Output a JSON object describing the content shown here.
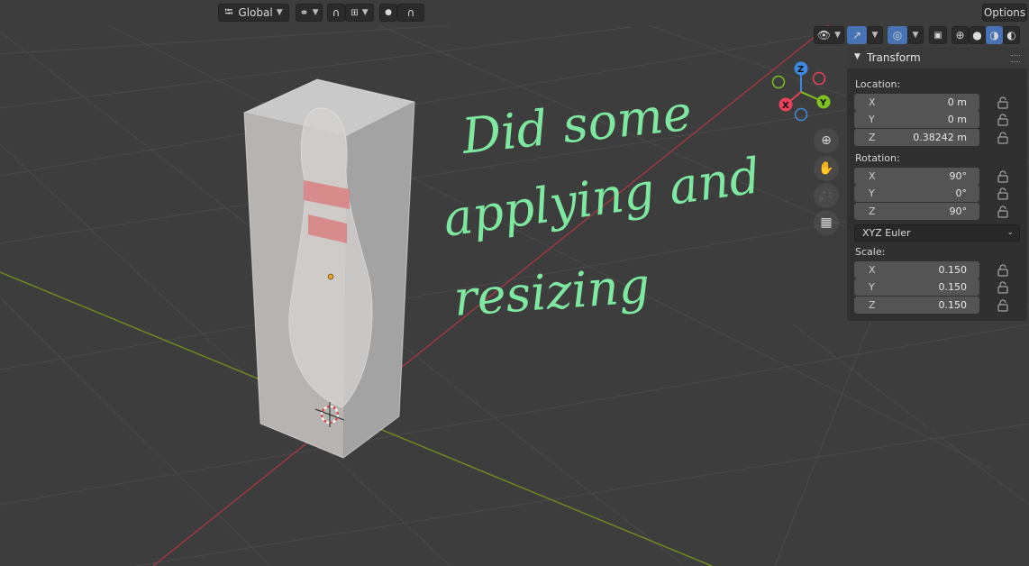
{
  "header": {
    "orientation_label": "Global",
    "options_label": "Options"
  },
  "annotation": {
    "line1": "Did some",
    "line2": "applying and",
    "line3": "resizing",
    "color": "#7ee8a0"
  },
  "panel": {
    "title": "Transform",
    "location": {
      "label": "Location:",
      "fields": [
        {
          "axis": "X",
          "value": "0 m"
        },
        {
          "axis": "Y",
          "value": "0 m"
        },
        {
          "axis": "Z",
          "value": "0.38242 m"
        }
      ]
    },
    "rotation": {
      "label": "Rotation:",
      "fields": [
        {
          "axis": "X",
          "value": "90°"
        },
        {
          "axis": "Y",
          "value": "0°"
        },
        {
          "axis": "Z",
          "value": "90°"
        }
      ],
      "mode": "XYZ Euler"
    },
    "scale": {
      "label": "Scale:",
      "fields": [
        {
          "axis": "X",
          "value": "0.150"
        },
        {
          "axis": "Y",
          "value": "0.150"
        },
        {
          "axis": "Z",
          "value": "0.150"
        }
      ]
    }
  },
  "gizmo": {
    "x_label": "X",
    "y_label": "Y",
    "z_label": "Z",
    "x_color": "#e8425a",
    "y_color": "#7fc021",
    "z_color": "#3f8ae0"
  },
  "icons": {
    "nav": [
      "zoom-icon",
      "pan-hand-icon",
      "camera-icon",
      "grid-view-icon"
    ]
  }
}
